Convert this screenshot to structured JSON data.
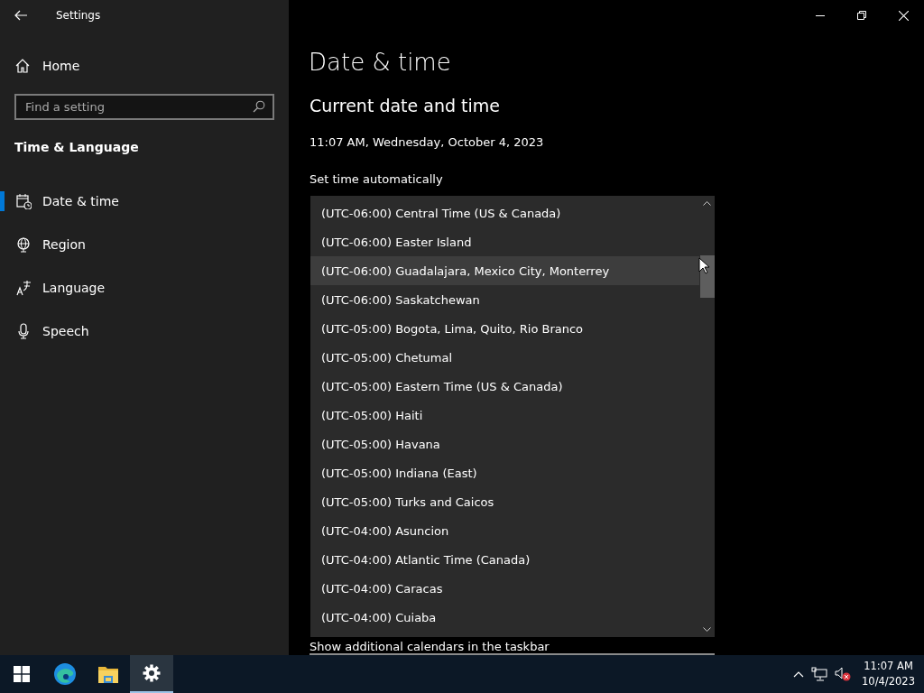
{
  "window": {
    "title": "Settings"
  },
  "sidebar": {
    "home": "Home",
    "search": {
      "placeholder": "Find a setting"
    },
    "section": "Time & Language",
    "items": [
      {
        "kind": "calendar",
        "label": "Date & time",
        "selected": true
      },
      {
        "kind": "globe",
        "label": "Region",
        "selected": false
      },
      {
        "kind": "language",
        "label": "Language",
        "selected": false
      },
      {
        "kind": "mic",
        "label": "Speech",
        "selected": false
      }
    ]
  },
  "main": {
    "title": "Date & time",
    "subtitle": "Current date and time",
    "current": "11:07 AM, Wednesday, October 4, 2023",
    "set_time_label": "Set time automatically",
    "calendars_label": "Show additional calendars in the taskbar"
  },
  "timezone_list": {
    "items": [
      {
        "label": "(UTC-06:00) Central Time (US & Canada)",
        "hovered": false
      },
      {
        "label": "(UTC-06:00) Easter Island",
        "hovered": false
      },
      {
        "label": "(UTC-06:00) Guadalajara, Mexico City, Monterrey",
        "hovered": true
      },
      {
        "label": "(UTC-06:00) Saskatchewan",
        "hovered": false
      },
      {
        "label": "(UTC-05:00) Bogota, Lima, Quito, Rio Branco",
        "hovered": false
      },
      {
        "label": "(UTC-05:00) Chetumal",
        "hovered": false
      },
      {
        "label": "(UTC-05:00) Eastern Time (US & Canada)",
        "hovered": false
      },
      {
        "label": "(UTC-05:00) Haiti",
        "hovered": false
      },
      {
        "label": "(UTC-05:00) Havana",
        "hovered": false
      },
      {
        "label": "(UTC-05:00) Indiana (East)",
        "hovered": false
      },
      {
        "label": "(UTC-05:00) Turks and Caicos",
        "hovered": false
      },
      {
        "label": "(UTC-04:00) Asuncion",
        "hovered": false
      },
      {
        "label": "(UTC-04:00) Atlantic Time (Canada)",
        "hovered": false
      },
      {
        "label": "(UTC-04:00) Caracas",
        "hovered": false
      },
      {
        "label": "(UTC-04:00) Cuiaba",
        "hovered": false
      }
    ]
  },
  "taskbar": {
    "apps": [
      {
        "kind": "start",
        "active": false
      },
      {
        "kind": "browser",
        "active": false
      },
      {
        "kind": "folder",
        "active": false
      },
      {
        "kind": "gear",
        "active": true
      }
    ],
    "clock": {
      "time": "11:07 AM",
      "date": "10/4/2023"
    }
  }
}
